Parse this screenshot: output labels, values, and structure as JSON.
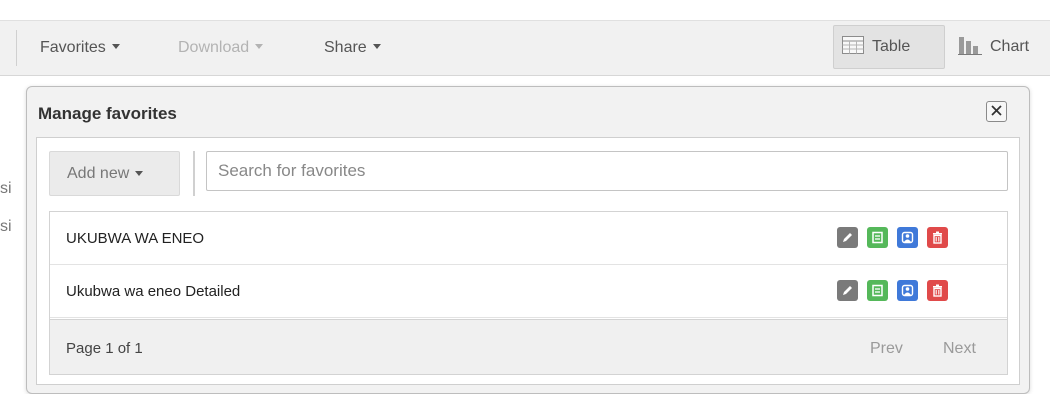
{
  "toolbar": {
    "favorites_label": "Favorites",
    "download_label": "Download",
    "share_label": "Share",
    "table_label": "Table",
    "chart_label": "Chart"
  },
  "background": {
    "stub_1": "si",
    "stub_2": "si"
  },
  "dialog": {
    "title": "Manage favorites",
    "add_new_label": "Add new",
    "search_placeholder": "Search for favorites",
    "search_value": "",
    "items": [
      {
        "name": "UKUBWA WA ENEO"
      },
      {
        "name": "Ukubwa wa eneo Detailed"
      }
    ],
    "pager": {
      "info": "Page 1 of 1",
      "prev_label": "Prev",
      "next_label": "Next"
    }
  },
  "colors": {
    "edit": "#7a7a7a",
    "report": "#55b85a",
    "share": "#3f79d9",
    "delete": "#e04a4a"
  },
  "icons": [
    "table-icon",
    "chart-icon",
    "close-icon",
    "edit-icon",
    "report-icon",
    "share-user-icon",
    "delete-icon"
  ]
}
